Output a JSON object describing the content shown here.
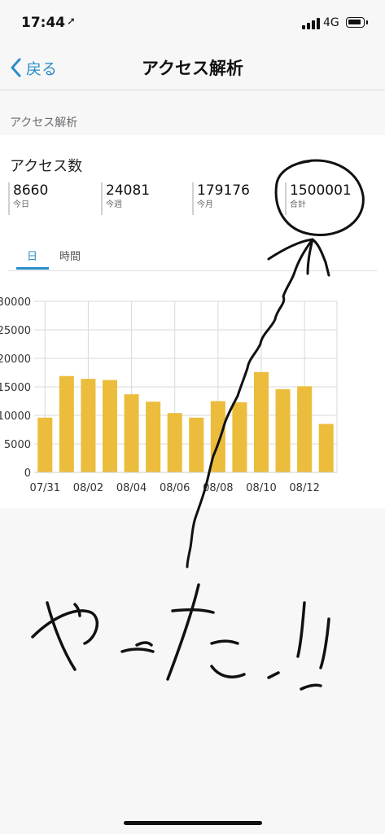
{
  "status_bar": {
    "time": "17:44",
    "network": "4G"
  },
  "nav": {
    "back_label": "戻る",
    "title": "アクセス解析"
  },
  "section": {
    "header": "アクセス解析"
  },
  "access": {
    "title": "アクセス数",
    "stats": [
      {
        "value": "8660",
        "label": "今日"
      },
      {
        "value": "24081",
        "label": "今週"
      },
      {
        "value": "179176",
        "label": "今月"
      },
      {
        "value": "1500001",
        "label": "合計"
      }
    ]
  },
  "tabs": {
    "day": "日",
    "hour": "時間",
    "selected": "日"
  },
  "colors": {
    "accent": "#2a8ec8",
    "bar": "#ecbd3c"
  },
  "chart_data": {
    "type": "bar",
    "categories": [
      "07/31",
      "08/01",
      "08/02",
      "08/03",
      "08/04",
      "08/05",
      "08/06",
      "08/07",
      "08/08",
      "08/09",
      "08/10",
      "08/11",
      "08/12",
      "08/13"
    ],
    "x_tick_labels": [
      "07/31",
      "08/02",
      "08/04",
      "08/06",
      "08/08",
      "08/10",
      "08/12"
    ],
    "values": [
      9600,
      16900,
      16400,
      16200,
      13700,
      12400,
      10400,
      9600,
      12500,
      12300,
      17600,
      14600,
      15100,
      8500
    ],
    "y_ticks": [
      "30000",
      "25000",
      "20000",
      "15000",
      "10000",
      "5000",
      "0"
    ],
    "ylim": [
      0,
      30000
    ],
    "grid": true
  },
  "handwriting": {
    "text": "やったー!!"
  }
}
